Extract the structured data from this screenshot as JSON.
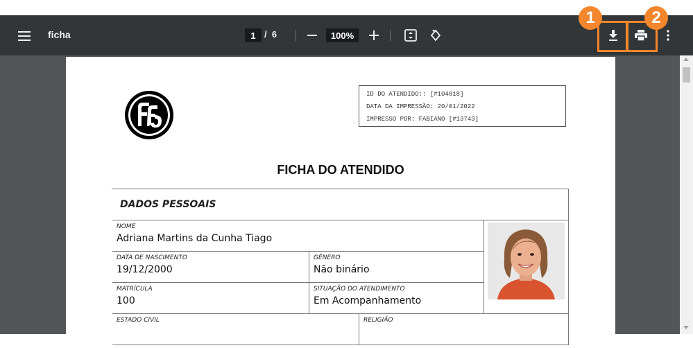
{
  "viewer": {
    "title": "ficha",
    "current_page": "1",
    "page_separator": "/",
    "total_pages": "6",
    "zoom": "100%",
    "icons": [
      "menu-icon",
      "minus-icon",
      "plus-icon",
      "fit-page-icon",
      "rotate-icon",
      "download-icon",
      "print-icon",
      "more-vert-icon"
    ]
  },
  "callouts": [
    {
      "number": "1",
      "target": "download-button",
      "color": "#f4862b"
    },
    {
      "number": "2",
      "target": "print-button",
      "color": "#f4862b"
    }
  ],
  "document": {
    "info": {
      "id_line": "ID DO ATENDIDO:: [#104818]",
      "date_line": "DATA DA IMPRESSÃO: 20/01/2022",
      "printed_by_line": "IMPRESSO POR: FABIANO [#13743]"
    },
    "title": "FICHA DO ATENDIDO",
    "section_title": "DADOS PESSOAIS",
    "fields": {
      "nome": {
        "label": "NOME",
        "value": "Adriana Martins da Cunha Tiago"
      },
      "nascimento": {
        "label": "DATA DE NASCIMENTO",
        "value": "19/12/2000"
      },
      "genero": {
        "label": "GÊNERO",
        "value": "Não binário"
      },
      "matricula": {
        "label": "MATRÍCULA",
        "value": "100"
      },
      "situacao": {
        "label": "SITUAÇÃO DO ATENDIMENTO",
        "value": "Em Acompanhamento"
      },
      "estado_civil": {
        "label": "ESTADO CIVIL",
        "value": ""
      },
      "religiao": {
        "label": "RELIGIÃO",
        "value": ""
      }
    }
  }
}
